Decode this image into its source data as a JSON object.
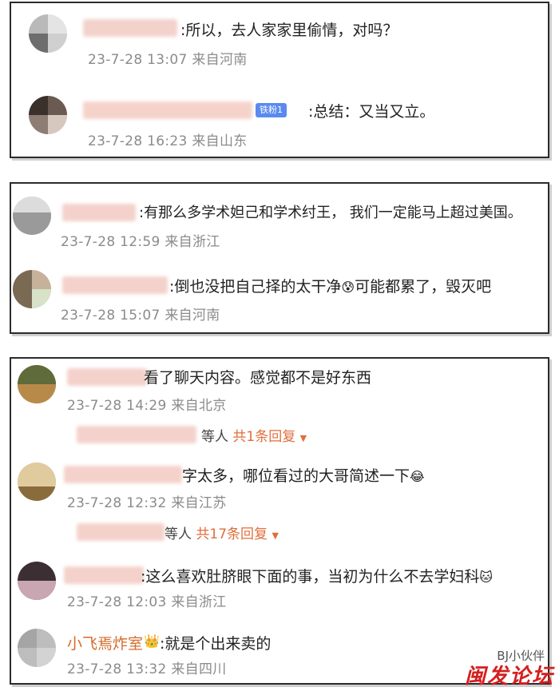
{
  "cards": [
    {
      "comments": [
        {
          "text": ":所以，去人家家里偷情，对吗？",
          "meta": "23-7-28 13:07 来自河南"
        },
        {
          "badge": "铁粉1",
          "text": ":总结：又当又立。",
          "meta": "23-7-28 16:23 来自山东"
        }
      ]
    },
    {
      "comments": [
        {
          "text": ":有那么多学术妲己和学术纣王， 我们一定能马上超过美国。",
          "meta": "23-7-28 12:59 来自浙江"
        },
        {
          "text": ":倒也没把自己择的太干净",
          "text_after": "可能都累了，毁灭吧",
          "meta": "23-7-28 15:07 来自河南"
        }
      ]
    },
    {
      "comments": [
        {
          "text": "看了聊天内容。感觉都不是好东西",
          "meta": "23-7-28 14:29 来自北京",
          "replies": {
            "who": "等人",
            "count": "共1条回复"
          }
        },
        {
          "text": "字太多，哪位看过的大哥简述一下",
          "meta": "23-7-28 12:32 来自江苏",
          "replies": {
            "who": "等人",
            "count": "共17条回复"
          }
        },
        {
          "text": ":这么喜欢肚脐眼下面的事，当初为什么不去学妇科",
          "meta": "23-7-28 12:03 来自浙江"
        },
        {
          "username": "小飞焉炸室",
          "text": ":就是个出来卖的",
          "meta": "23-7-28 13:32 来自四川"
        }
      ]
    }
  ],
  "watermark": {
    "small": "BJ小伙伴",
    "large": "闽发论坛"
  },
  "colors": {
    "meta_gray": "#8b8b8b",
    "reply_orange": "#e06e3c",
    "watermark_red": "#d51f1f",
    "badge_blue": "#5a8af0"
  }
}
